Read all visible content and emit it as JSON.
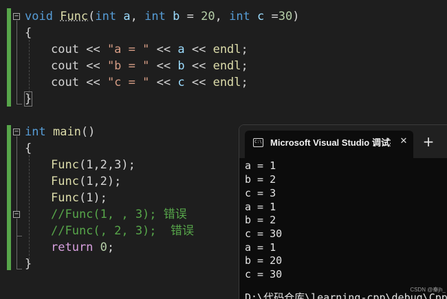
{
  "editor": {
    "func_block": {
      "signature": {
        "ret_type": "void",
        "name": "Func",
        "open_paren": "(",
        "p1_type": "int",
        "p1_name": "a",
        "sep1": ",",
        "p2_type": "int",
        "p2_name": "b",
        "p2_eq": "=",
        "p2_default": "20",
        "sep2": ",",
        "p3_type": "int",
        "p3_name": "c",
        "p3_eq": "=",
        "p3_default": "30",
        "close_paren": ")"
      },
      "open_brace": "{",
      "lines": [
        {
          "stream": "cout",
          "op1": "<<",
          "str": "\"a = \"",
          "op2": "<<",
          "var": "a",
          "op3": "<<",
          "end": "endl",
          "semi": ";"
        },
        {
          "stream": "cout",
          "op1": "<<",
          "str": "\"b = \"",
          "op2": "<<",
          "var": "b",
          "op3": "<<",
          "end": "endl",
          "semi": ";"
        },
        {
          "stream": "cout",
          "op1": "<<",
          "str": "\"c = \"",
          "op2": "<<",
          "var": "c",
          "op3": "<<",
          "end": "endl",
          "semi": ";"
        }
      ],
      "close_brace": "}"
    },
    "main_block": {
      "signature": {
        "ret_type": "int",
        "name": "main",
        "parens": "()"
      },
      "open_brace": "{",
      "calls": [
        {
          "name": "Func",
          "args": "(1,2,3);"
        },
        {
          "name": "Func",
          "args": "(1,2);"
        },
        {
          "name": "Func",
          "args": "(1);"
        }
      ],
      "comments": [
        "//Func(1, , 3); 错误",
        "//Func(, 2, 3);  错误"
      ],
      "return_kw": "return",
      "return_val": "0",
      "return_semi": ";",
      "close_brace": "}"
    }
  },
  "console": {
    "tab_title": "Microsoft Visual Studio 调试控制台",
    "icon_text": "C:\\",
    "close_glyph": "✕",
    "add_glyph": "+",
    "output": [
      "a = 1",
      "b = 2",
      "c = 3",
      "a = 1",
      "b = 2",
      "c = 30",
      "a = 1",
      "b = 20",
      "c = 30",
      "D:\\代码仓库\\learning-cpp\\debug\\Cpp.exe"
    ]
  },
  "watermark": "CSDN @秦jh_",
  "colors": {
    "background": "#1e1e1e",
    "keyword": "#569cd6",
    "function": "#dcdcaa",
    "string": "#d69d85",
    "comment": "#57a64a",
    "number": "#b5cea8",
    "console_bg": "#0c0c0c"
  }
}
